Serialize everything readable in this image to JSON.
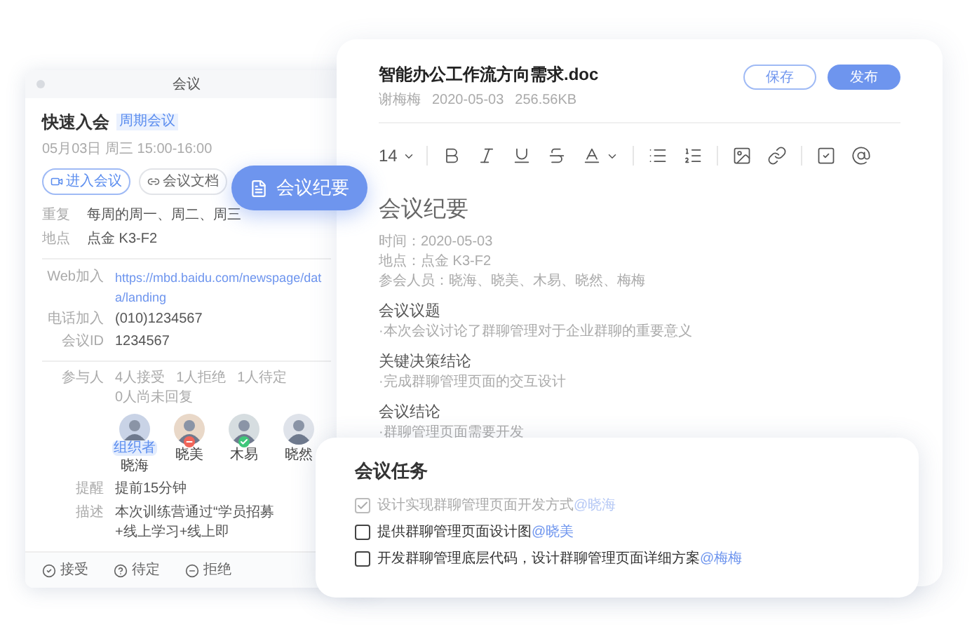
{
  "meeting": {
    "title": "会议",
    "name": "快速入会",
    "badge": "周期会议",
    "time": "05月03日 周三 15:00-16:00",
    "buttons": [
      {
        "label": "进入会议",
        "kind": "video"
      },
      {
        "label": "会议文档",
        "kind": "link"
      }
    ],
    "details": [
      {
        "label": "重复",
        "value": "每周的周一、周二、周三"
      },
      {
        "label": "地点",
        "value": "点金 K3-F2"
      }
    ],
    "join": [
      {
        "label": "Web加入",
        "value": "https://mbd.baidu.com/newspage/data/landing",
        "kind": "link"
      },
      {
        "label": "电话加入",
        "value": "(010)1234567",
        "kind": "text"
      },
      {
        "label": "会议ID",
        "value": "1234567",
        "kind": "text"
      }
    ],
    "participants": {
      "label": "参与人",
      "stats": [
        "4人接受",
        "1人拒绝",
        "1人待定",
        "0人尚未回复"
      ],
      "people": [
        {
          "name": "晓海",
          "role": "组织者",
          "declined": false,
          "accepted": false
        },
        {
          "name": "晓美",
          "declined": true,
          "accepted": false
        },
        {
          "name": "木易",
          "declined": false,
          "accepted": true
        },
        {
          "name": "晓然",
          "declined": false,
          "accepted": false
        }
      ]
    },
    "extra": [
      {
        "label": "提醒",
        "value": "提前15分钟"
      },
      {
        "label": "描述",
        "value": "本次训练营通过“学员招募+线上学习+线上即"
      }
    ],
    "actions": [
      {
        "label": "接受",
        "kind": "accept"
      },
      {
        "label": "待定",
        "kind": "pending"
      },
      {
        "label": "拒绝",
        "kind": "decline"
      }
    ]
  },
  "minutes_button": {
    "label": "会议纪要"
  },
  "document": {
    "title": "智能办公工作流方向需求.doc",
    "meta": [
      "谢梅梅",
      "2020-05-03",
      "256.56KB"
    ],
    "buttons": [
      {
        "label": "保存",
        "kind": "outline"
      },
      {
        "label": "发布",
        "kind": "filled"
      }
    ],
    "font_size": "14",
    "tool_groups": [
      [
        {
          "kind": "bold"
        },
        {
          "kind": "italic"
        },
        {
          "kind": "underline"
        },
        {
          "kind": "strike"
        },
        {
          "kind": "color"
        }
      ],
      [
        {
          "kind": "bullets"
        },
        {
          "kind": "numbers"
        }
      ],
      [
        {
          "kind": "image"
        },
        {
          "kind": "link"
        }
      ],
      [
        {
          "kind": "task"
        },
        {
          "kind": "mention"
        }
      ]
    ],
    "heading": "会议纪要",
    "info": [
      "时间：2020-05-03",
      "地点：点金 K3-F2",
      "参会人员：晓海、晓美、木易、晓然、梅梅"
    ],
    "sections": [
      {
        "title": "会议议题",
        "body": "·本次会议讨论了群聊管理对于企业群聊的重要意义"
      },
      {
        "title": "关键决策结论",
        "body": "·完成群聊管理页面的交互设计"
      },
      {
        "title": "会议结论",
        "body": "·群聊管理页面需要开发"
      }
    ]
  },
  "tasks": {
    "title": "会议任务",
    "items": [
      {
        "text": "设计实现群聊管理页面开发方式",
        "mention": "@晓海",
        "checked": true
      },
      {
        "text": "提供群聊管理页面设计图",
        "mention": "@晓美",
        "checked": false
      },
      {
        "text": "开发群聊管理底层代码，设计群聊管理页面详细方案",
        "mention": "@梅梅",
        "checked": false
      }
    ]
  }
}
